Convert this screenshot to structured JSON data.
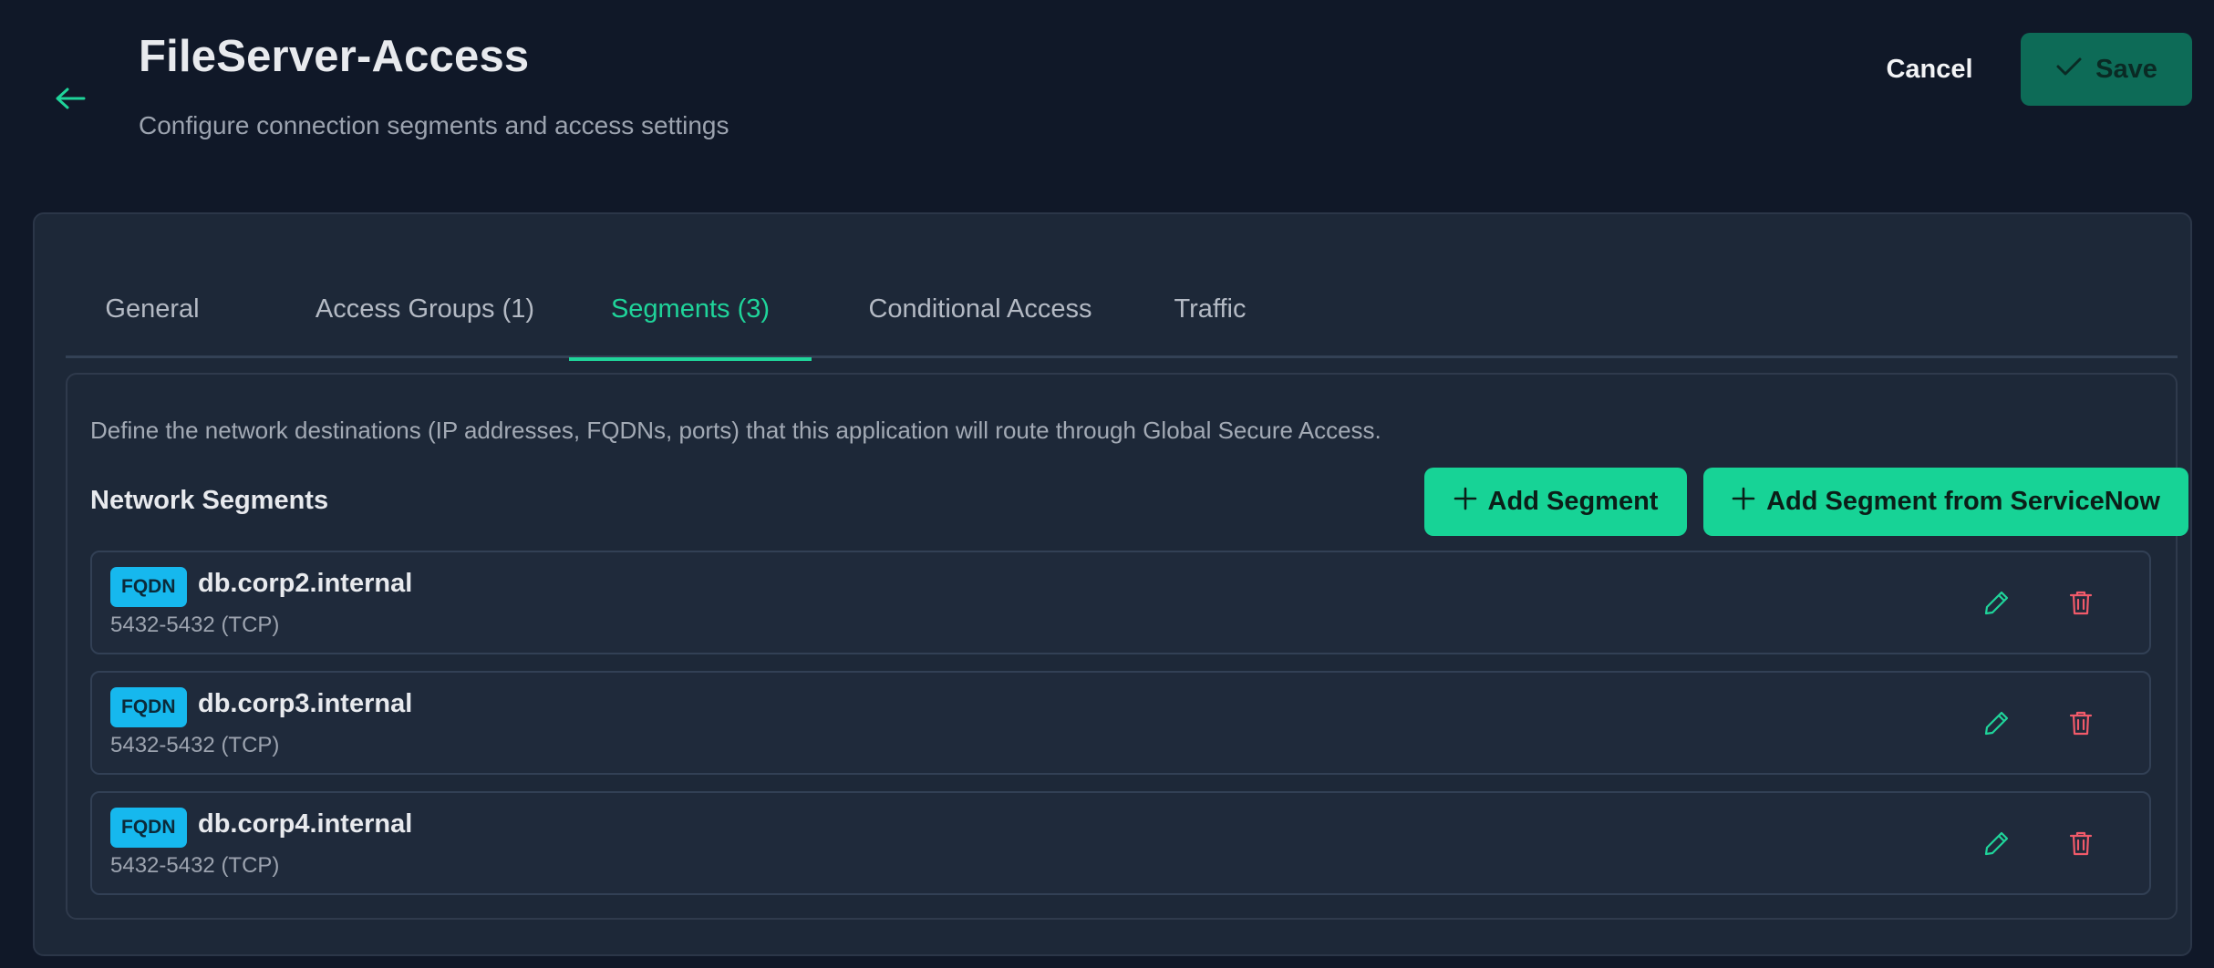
{
  "header": {
    "back_icon": "arrow-left-icon",
    "title": "FileServer-Access",
    "subtitle": "Configure connection segments and access settings",
    "cancel_label": "Cancel",
    "save_label": "Save",
    "save_icon": "check-icon"
  },
  "tabs": [
    {
      "label": "General",
      "active": false
    },
    {
      "label": "Access Groups (1)",
      "active": false
    },
    {
      "label": "Segments (3)",
      "active": true
    },
    {
      "label": "Conditional Access",
      "active": false
    },
    {
      "label": "Traffic",
      "active": false
    }
  ],
  "segments_panel": {
    "description": "Define the network destinations (IP addresses, FQDNs, ports) that this application will route through Global Secure Access.",
    "section_title": "Network Segments",
    "add_segment_label": "Add Segment",
    "add_servicenow_label": "Add Segment from ServiceNow",
    "segments": [
      {
        "type": "FQDN",
        "name": "db.corp2.internal",
        "ports": "5432-5432 (TCP)"
      },
      {
        "type": "FQDN",
        "name": "db.corp3.internal",
        "ports": "5432-5432 (TCP)"
      },
      {
        "type": "FQDN",
        "name": "db.corp4.internal",
        "ports": "5432-5432 (TCP)"
      }
    ]
  },
  "colors": {
    "background": "#101828",
    "card": "#1d2838",
    "accent": "#1fd49a",
    "save_button": "#0d6b57",
    "badge": "#16b8ee",
    "delete_icon": "#f05a6a"
  }
}
